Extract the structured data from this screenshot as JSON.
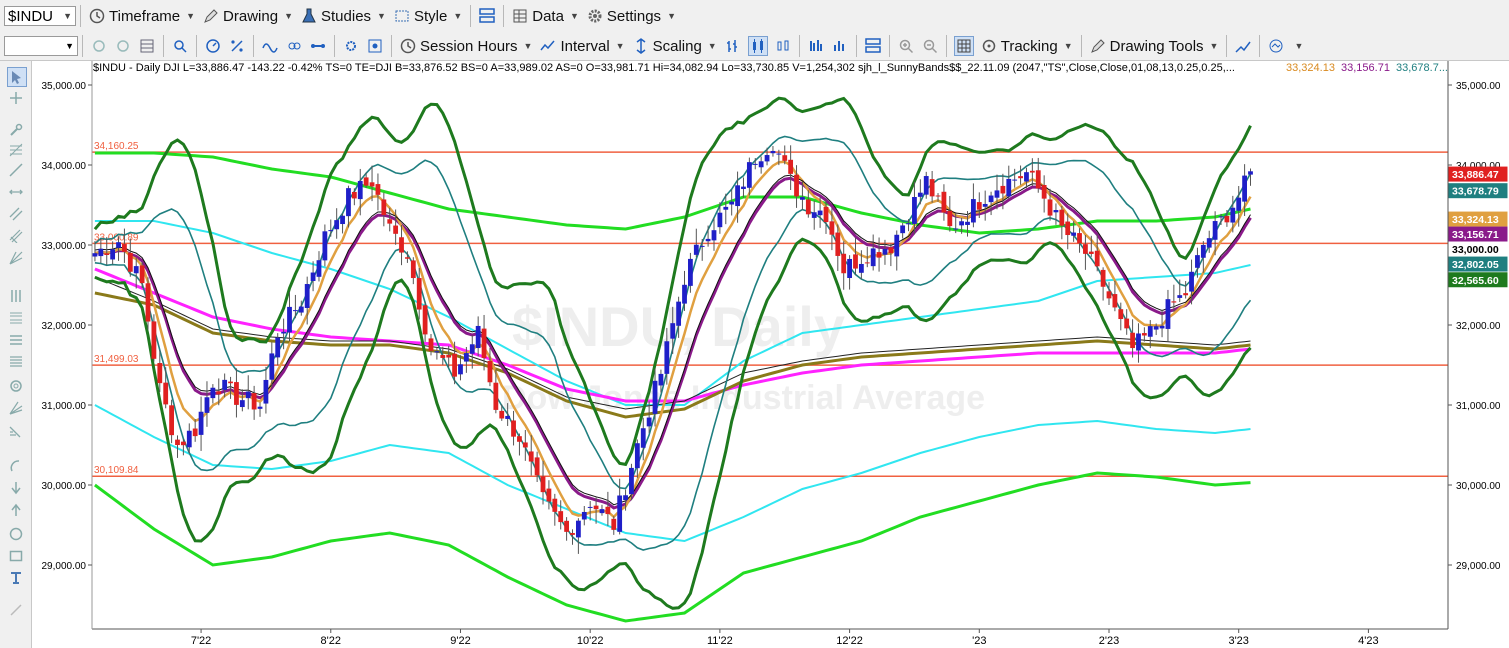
{
  "toolbar1": {
    "symbol": "$INDU",
    "timeframe": "Timeframe",
    "drawing": "Drawing",
    "studies": "Studies",
    "style": "Style",
    "data": "Data",
    "settings": "Settings"
  },
  "toolbar2": {
    "session_hours": "Session Hours",
    "interval": "Interval",
    "scaling": "Scaling",
    "tracking": "Tracking",
    "drawing_tools": "Drawing Tools"
  },
  "chart_header": {
    "text": "$INDU - Daily  DJI  L=33,886.47  -143.22  -0.42%  TS=0  TE=DJI  B=33,876.52  BS=0  A=33,989.02  AS=0  O=33,981.71  Hi=34,082.94  Lo=33,730.85  V=1,254,302  sjh_l_SunnyBands$$_22.11.09 (2047,\"TS\",Close,Close,01,08,13,0.25,0.25,...",
    "val1": "33,324.13",
    "val2": "33,156.71",
    "val3": "33,678.7..."
  },
  "watermark": {
    "line1": "$INDU, Daily",
    "line2": "Dow Jones Industrial Average"
  },
  "colors": {
    "up": "#1f1fc8",
    "down": "#e02020",
    "hline": "#f06040",
    "green": "#22dd22",
    "darkgreen": "#1e7a1e",
    "cyan": "#30e6f0",
    "magenta": "#ff22ff",
    "olive": "#8a7a1a",
    "purple": "#8a1a8a",
    "orange": "#e0a040",
    "teal": "#1f7f80"
  },
  "chart_data": {
    "type": "candlestick",
    "y_axis": {
      "min": 28200,
      "max": 35300,
      "ticks": [
        35000,
        34000,
        33000,
        32000,
        31000,
        30000,
        29000
      ],
      "tick_labels": [
        "35,000.00",
        "34,000.00",
        "33,000.00",
        "32,000.00",
        "31,000.00",
        "30,000.00",
        "29,000.00"
      ]
    },
    "x_axis": {
      "labels": [
        "7'22",
        "8'22",
        "9'22",
        "10'22",
        "11'22",
        "12'22",
        "'23",
        "2'23",
        "3'23",
        "4'23"
      ],
      "label_index": [
        18,
        40,
        62,
        84,
        106,
        128,
        150,
        172,
        194,
        216
      ]
    },
    "n_bars": 230,
    "close_anchors": [
      [
        0,
        32900
      ],
      [
        4,
        33050
      ],
      [
        8,
        32500
      ],
      [
        11,
        31200
      ],
      [
        14,
        30500
      ],
      [
        17,
        30700
      ],
      [
        20,
        31300
      ],
      [
        24,
        31100
      ],
      [
        28,
        31000
      ],
      [
        31,
        31900
      ],
      [
        35,
        32300
      ],
      [
        39,
        33100
      ],
      [
        43,
        33600
      ],
      [
        47,
        33800
      ],
      [
        50,
        33200
      ],
      [
        53,
        32900
      ],
      [
        57,
        31700
      ],
      [
        61,
        31400
      ],
      [
        65,
        31900
      ],
      [
        68,
        31000
      ],
      [
        72,
        30600
      ],
      [
        76,
        29800
      ],
      [
        80,
        29400
      ],
      [
        84,
        29800
      ],
      [
        88,
        29500
      ],
      [
        92,
        30500
      ],
      [
        96,
        31400
      ],
      [
        100,
        32600
      ],
      [
        104,
        33200
      ],
      [
        108,
        33500
      ],
      [
        112,
        34100
      ],
      [
        115,
        34300
      ],
      [
        118,
        33800
      ],
      [
        121,
        33500
      ],
      [
        124,
        33400
      ],
      [
        127,
        32700
      ],
      [
        131,
        32900
      ],
      [
        135,
        33000
      ],
      [
        138,
        33400
      ],
      [
        141,
        33800
      ],
      [
        145,
        33200
      ],
      [
        148,
        33400
      ],
      [
        152,
        33700
      ],
      [
        155,
        33800
      ],
      [
        158,
        33900
      ],
      [
        161,
        33600
      ],
      [
        164,
        33200
      ],
      [
        168,
        32900
      ],
      [
        171,
        32500
      ],
      [
        174,
        32000
      ],
      [
        176,
        31700
      ],
      [
        179,
        31900
      ],
      [
        182,
        32200
      ],
      [
        185,
        32400
      ],
      [
        188,
        33000
      ],
      [
        191,
        33300
      ],
      [
        194,
        33600
      ],
      [
        196,
        33880
      ]
    ],
    "candles": [],
    "horizontal_lines": [
      {
        "value": 34160.25,
        "label": "34,160.25"
      },
      {
        "value": 33020,
        "label": "33,000.89"
      },
      {
        "value": 31499.03,
        "label": "31,499.03"
      },
      {
        "value": 30109.84,
        "label": "30,109.84"
      }
    ],
    "series": [
      {
        "color": "#22dd22",
        "width": 3,
        "values": [
          [
            0,
            34150
          ],
          [
            10,
            34150
          ],
          [
            20,
            34100
          ],
          [
            30,
            33950
          ],
          [
            40,
            33850
          ],
          [
            50,
            33650
          ],
          [
            60,
            33450
          ],
          [
            70,
            33350
          ],
          [
            80,
            33250
          ],
          [
            90,
            33200
          ],
          [
            100,
            33350
          ],
          [
            110,
            33600
          ],
          [
            120,
            33600
          ],
          [
            130,
            33400
          ],
          [
            140,
            33250
          ],
          [
            150,
            33150
          ],
          [
            160,
            33200
          ],
          [
            170,
            33300
          ],
          [
            180,
            33300
          ],
          [
            190,
            33350
          ],
          [
            196,
            33450
          ]
        ]
      },
      {
        "color": "#22dd22",
        "width": 3,
        "values": [
          [
            0,
            30000
          ],
          [
            10,
            29450
          ],
          [
            20,
            29000
          ],
          [
            30,
            29100
          ],
          [
            40,
            29300
          ],
          [
            50,
            29400
          ],
          [
            60,
            29250
          ],
          [
            70,
            28850
          ],
          [
            80,
            28500
          ],
          [
            90,
            28300
          ],
          [
            100,
            28400
          ],
          [
            110,
            28900
          ],
          [
            120,
            29100
          ],
          [
            130,
            29300
          ],
          [
            140,
            29600
          ],
          [
            150,
            29800
          ],
          [
            160,
            30000
          ],
          [
            170,
            30150
          ],
          [
            180,
            30100
          ],
          [
            190,
            30000
          ],
          [
            196,
            30030
          ]
        ]
      },
      {
        "color": "#30e6f0",
        "width": 2,
        "values": [
          [
            0,
            33300
          ],
          [
            10,
            33300
          ],
          [
            20,
            33150
          ],
          [
            30,
            32900
          ],
          [
            40,
            32700
          ],
          [
            50,
            32450
          ],
          [
            60,
            32100
          ],
          [
            70,
            31700
          ],
          [
            80,
            31300
          ],
          [
            90,
            31000
          ],
          [
            100,
            31000
          ],
          [
            110,
            31550
          ],
          [
            120,
            31900
          ],
          [
            130,
            32000
          ],
          [
            140,
            32100
          ],
          [
            150,
            32200
          ],
          [
            160,
            32300
          ],
          [
            170,
            32550
          ],
          [
            180,
            32600
          ],
          [
            190,
            32650
          ],
          [
            196,
            32750
          ]
        ]
      },
      {
        "color": "#30e6f0",
        "width": 2,
        "values": [
          [
            0,
            31000
          ],
          [
            10,
            30600
          ],
          [
            20,
            30250
          ],
          [
            30,
            30200
          ],
          [
            40,
            30300
          ],
          [
            50,
            30500
          ],
          [
            60,
            30400
          ],
          [
            70,
            30000
          ],
          [
            80,
            29700
          ],
          [
            90,
            29400
          ],
          [
            100,
            29300
          ],
          [
            110,
            29600
          ],
          [
            120,
            29950
          ],
          [
            130,
            30150
          ],
          [
            140,
            30400
          ],
          [
            150,
            30600
          ],
          [
            160,
            30750
          ],
          [
            170,
            30800
          ],
          [
            180,
            30700
          ],
          [
            190,
            30650
          ],
          [
            196,
            30700
          ]
        ]
      },
      {
        "color": "#ff22ff",
        "width": 3,
        "values": [
          [
            0,
            32700
          ],
          [
            10,
            32400
          ],
          [
            20,
            32100
          ],
          [
            30,
            31950
          ],
          [
            40,
            31850
          ],
          [
            50,
            31800
          ],
          [
            60,
            31750
          ],
          [
            70,
            31500
          ],
          [
            80,
            31200
          ],
          [
            90,
            31050
          ],
          [
            100,
            31050
          ],
          [
            110,
            31250
          ],
          [
            120,
            31400
          ],
          [
            130,
            31500
          ],
          [
            140,
            31550
          ],
          [
            150,
            31600
          ],
          [
            160,
            31650
          ],
          [
            170,
            31650
          ],
          [
            180,
            31650
          ],
          [
            190,
            31650
          ],
          [
            196,
            31700
          ]
        ]
      },
      {
        "color": "#8a7a1a",
        "width": 3,
        "values": [
          [
            0,
            32400
          ],
          [
            10,
            32250
          ],
          [
            20,
            31900
          ],
          [
            30,
            31800
          ],
          [
            40,
            31750
          ],
          [
            50,
            31750
          ],
          [
            60,
            31650
          ],
          [
            70,
            31400
          ],
          [
            80,
            31050
          ],
          [
            90,
            30850
          ],
          [
            100,
            30950
          ],
          [
            110,
            31300
          ],
          [
            120,
            31500
          ],
          [
            130,
            31600
          ],
          [
            140,
            31650
          ],
          [
            150,
            31700
          ],
          [
            160,
            31750
          ],
          [
            170,
            31800
          ],
          [
            180,
            31750
          ],
          [
            190,
            31700
          ],
          [
            196,
            31750
          ]
        ]
      },
      {
        "color": "#222222",
        "width": 1,
        "values": [
          [
            0,
            32600
          ],
          [
            10,
            32300
          ],
          [
            20,
            31950
          ],
          [
            30,
            31850
          ],
          [
            40,
            31800
          ],
          [
            50,
            31800
          ],
          [
            60,
            31700
          ],
          [
            70,
            31450
          ],
          [
            80,
            31100
          ],
          [
            90,
            30950
          ],
          [
            100,
            31050
          ],
          [
            110,
            31400
          ],
          [
            120,
            31550
          ],
          [
            130,
            31650
          ],
          [
            140,
            31700
          ],
          [
            150,
            31750
          ],
          [
            160,
            31800
          ],
          [
            170,
            31850
          ],
          [
            180,
            31800
          ],
          [
            190,
            31750
          ],
          [
            196,
            31800
          ]
        ]
      }
    ],
    "price_labels": [
      {
        "value": 33886.47,
        "label": "33,886.47",
        "bg": "#e02020",
        "fg": "#ffffff"
      },
      {
        "value": 33678.79,
        "label": "33,678.79",
        "bg": "#1f7f80",
        "fg": "#ffffff"
      },
      {
        "value": 33324.13,
        "label": "33,324.13",
        "bg": "#e0a040",
        "fg": "#ffffff"
      },
      {
        "value": 33156.71,
        "label": "33,156.71",
        "bg": "#8a1a8a",
        "fg": "#ffffff"
      },
      {
        "value": 33000.89,
        "label": "33,000.00",
        "bg": "#ffffff",
        "fg": "#000000"
      },
      {
        "value": 32802.05,
        "label": "32,802.05",
        "bg": "#1f7f80",
        "fg": "#ffffff"
      },
      {
        "value": 32565.6,
        "label": "32,565.60",
        "bg": "#1e7a1e",
        "fg": "#ffffff"
      }
    ]
  }
}
